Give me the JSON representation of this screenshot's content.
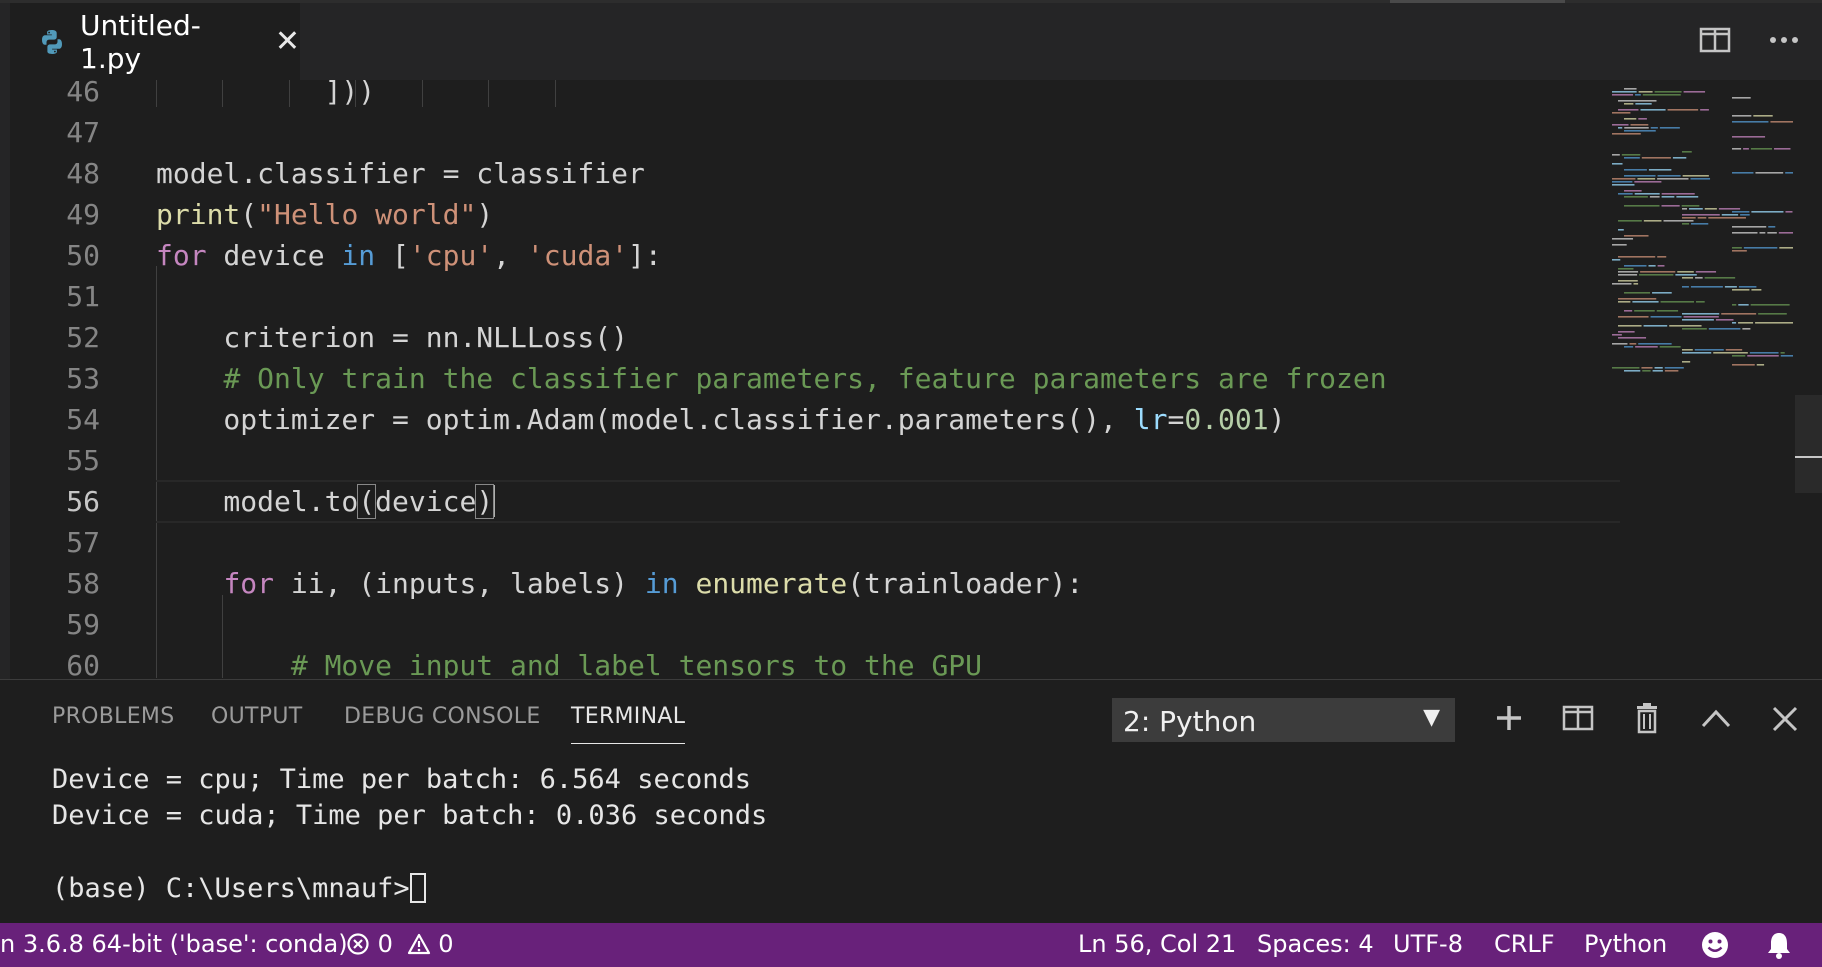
{
  "tab": {
    "title": "Untitled-1.py",
    "close": "✕"
  },
  "editor": {
    "lines": [
      {
        "n": "46",
        "tokens": [
          {
            "t": "          ",
            "c": ""
          },
          {
            "t": "]))",
            "c": ""
          }
        ]
      },
      {
        "n": "47",
        "tokens": []
      },
      {
        "n": "48",
        "tokens": [
          {
            "t": "model.classifier = classifier",
            "c": ""
          }
        ]
      },
      {
        "n": "49",
        "tokens": [
          {
            "t": "print",
            "c": "tk-fn"
          },
          {
            "t": "(",
            "c": ""
          },
          {
            "t": "\"Hello world\"",
            "c": "tk-str"
          },
          {
            "t": ")",
            "c": ""
          }
        ]
      },
      {
        "n": "50",
        "tokens": [
          {
            "t": "for",
            "c": "tk-kw"
          },
          {
            "t": " device ",
            "c": ""
          },
          {
            "t": "in",
            "c": "tk-kw2"
          },
          {
            "t": " [",
            "c": ""
          },
          {
            "t": "'cpu'",
            "c": "tk-str"
          },
          {
            "t": ", ",
            "c": ""
          },
          {
            "t": "'cuda'",
            "c": "tk-str"
          },
          {
            "t": "]:",
            "c": ""
          }
        ]
      },
      {
        "n": "51",
        "tokens": []
      },
      {
        "n": "52",
        "tokens": [
          {
            "t": "    criterion = nn.NLLLoss()",
            "c": ""
          }
        ]
      },
      {
        "n": "53",
        "tokens": [
          {
            "t": "    ",
            "c": ""
          },
          {
            "t": "# Only train the classifier parameters, feature parameters are frozen",
            "c": "tk-com"
          }
        ]
      },
      {
        "n": "54",
        "tokens": [
          {
            "t": "    optimizer = optim.Adam(model.classifier.parameters(), ",
            "c": ""
          },
          {
            "t": "lr",
            "c": "tk-param"
          },
          {
            "t": "=",
            "c": ""
          },
          {
            "t": "0.001",
            "c": "tk-num"
          },
          {
            "t": ")",
            "c": ""
          }
        ]
      },
      {
        "n": "55",
        "tokens": []
      },
      {
        "n": "56",
        "tokens": [
          {
            "t": "    model.to",
            "c": ""
          },
          {
            "t": "(",
            "c": "brk"
          },
          {
            "t": "device",
            "c": ""
          },
          {
            "t": ")",
            "c": "brk"
          }
        ],
        "current": true
      },
      {
        "n": "57",
        "tokens": []
      },
      {
        "n": "58",
        "tokens": [
          {
            "t": "    ",
            "c": ""
          },
          {
            "t": "for",
            "c": "tk-kw"
          },
          {
            "t": " ii, (inputs, labels) ",
            "c": ""
          },
          {
            "t": "in",
            "c": "tk-kw2"
          },
          {
            "t": " ",
            "c": ""
          },
          {
            "t": "enumerate",
            "c": "tk-fn"
          },
          {
            "t": "(trainloader):",
            "c": ""
          }
        ]
      },
      {
        "n": "59",
        "tokens": []
      },
      {
        "n": "60",
        "tokens": [
          {
            "t": "        ",
            "c": ""
          },
          {
            "t": "# Move input and label tensors to the GPU",
            "c": "tk-com"
          }
        ]
      }
    ]
  },
  "panel": {
    "tabs": [
      "PROBLEMS",
      "OUTPUT",
      "DEBUG CONSOLE",
      "TERMINAL"
    ],
    "active_tab": "TERMINAL",
    "terminal_select": "2: Python",
    "terminal_lines": [
      "Device = cpu; Time per batch: 6.564 seconds",
      "Device = cuda; Time per batch: 0.036 seconds",
      "",
      "(base) C:\\Users\\mnauf>"
    ]
  },
  "statusbar": {
    "interpreter": "n 3.6.8 64-bit ('base': conda)",
    "errors": "0",
    "warnings": "0",
    "position": "Ln 56, Col 21",
    "spaces": "Spaces: 4",
    "encoding": "UTF-8",
    "eol": "CRLF",
    "language": "Python",
    "color": "#68217a"
  },
  "icons": {
    "python": "python-file-icon",
    "split": "split-editor-icon",
    "more": "more-actions-icon",
    "add": "plus-icon",
    "trash": "trash-icon",
    "chevron": "chevron-up-icon",
    "close": "close-icon",
    "feedback": "smiley-icon",
    "bell": "bell-icon"
  }
}
